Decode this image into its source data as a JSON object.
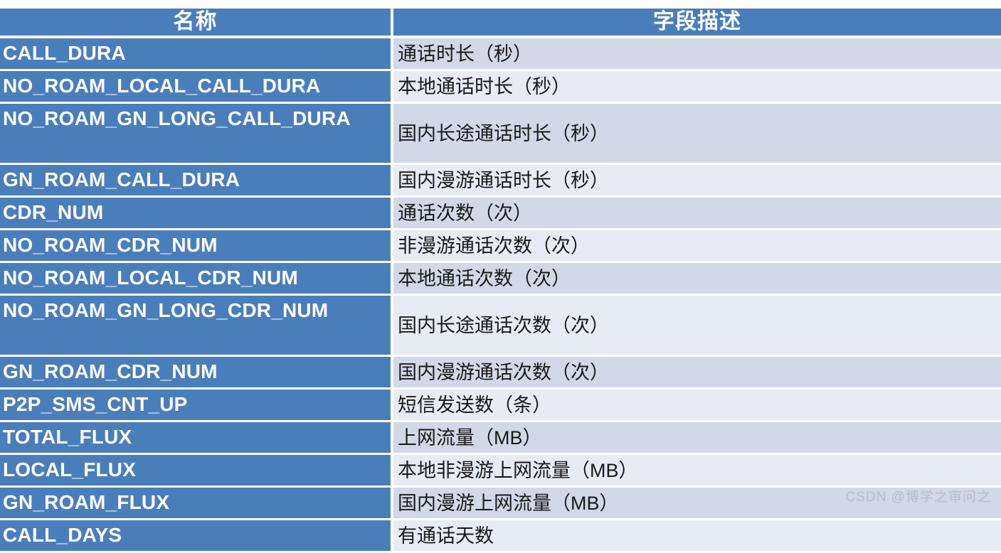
{
  "table": {
    "headers": {
      "name": "名称",
      "description": "字段描述"
    },
    "rows": [
      {
        "name": "CALL_DURA",
        "description": "通话时长（秒）",
        "tall": false
      },
      {
        "name": "NO_ROAM_LOCAL_CALL_DURA",
        "description": "本地通话时长（秒）",
        "tall": false
      },
      {
        "name": "NO_ROAM_GN_LONG_CALL_DURA",
        "description": "国内长途通话时长（秒）",
        "tall": true
      },
      {
        "name": "GN_ROAM_CALL_DURA",
        "description": "国内漫游通话时长（秒）",
        "tall": false
      },
      {
        "name": "CDR_NUM",
        "description": "通话次数（次）",
        "tall": false
      },
      {
        "name": "NO_ROAM_CDR_NUM",
        "description": "非漫游通话次数（次）",
        "tall": false
      },
      {
        "name": "NO_ROAM_LOCAL_CDR_NUM",
        "description": "本地通话次数（次）",
        "tall": false
      },
      {
        "name": "NO_ROAM_GN_LONG_CDR_NUM",
        "description": "国内长途通话次数（次）",
        "tall": true
      },
      {
        "name": "GN_ROAM_CDR_NUM",
        "description": "国内漫游通话次数（次）",
        "tall": false
      },
      {
        "name": "P2P_SMS_CNT_UP",
        "description": "短信发送数（条）",
        "tall": false
      },
      {
        "name": "TOTAL_FLUX",
        "description": "上网流量（MB）",
        "tall": false
      },
      {
        "name": "LOCAL_FLUX",
        "description": "本地非漫游上网流量（MB）",
        "tall": false
      },
      {
        "name": "GN_ROAM_FLUX",
        "description": "国内漫游上网流量（MB）",
        "tall": false
      },
      {
        "name": "CALL_DAYS",
        "description": "有通话天数",
        "tall": false
      }
    ]
  },
  "watermark": {
    "text": "CSDN @博学之审问之"
  },
  "colors": {
    "header_blue": "#4A7EBB",
    "name_blue": "#4A7EBB",
    "row_shade_dark": "#D2D8E6",
    "row_shade_light": "#E7EBF4",
    "name_text": "#FFFFFF",
    "desc_text": "#1A1A1A",
    "watermark_text": "#B9BFC9"
  }
}
